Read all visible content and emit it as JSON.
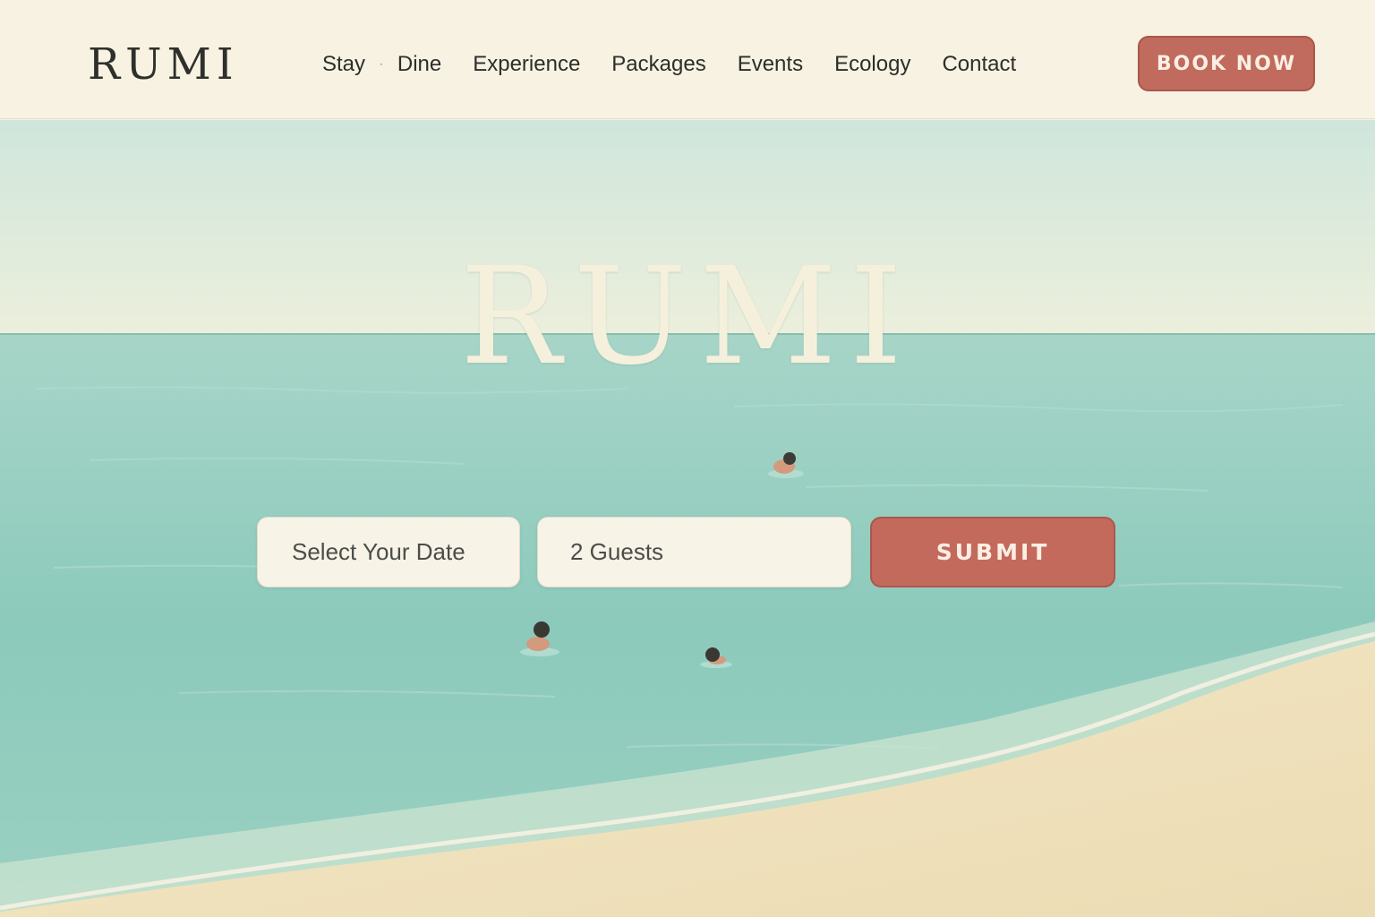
{
  "header": {
    "logo": "RUMI",
    "nav": [
      {
        "label": "Stay"
      },
      {
        "label": "Dine"
      },
      {
        "label": "Experience"
      },
      {
        "label": "Packages"
      },
      {
        "label": "Events"
      },
      {
        "label": "Ecology"
      },
      {
        "label": "Contact"
      }
    ],
    "nav_separator": "·",
    "book_now_label": "BOOK NOW"
  },
  "hero": {
    "title": "RUMI",
    "date_field": "Select Your Date",
    "guests_field": "2 Guests",
    "submit_label": "SUBMIT"
  },
  "colors": {
    "header_bg": "#f7f2e2",
    "accent": "#c16a5e",
    "sea": "#8fcbbd",
    "sky": "#dcece0",
    "sand": "#efe1bd",
    "text": "#2f302b"
  }
}
